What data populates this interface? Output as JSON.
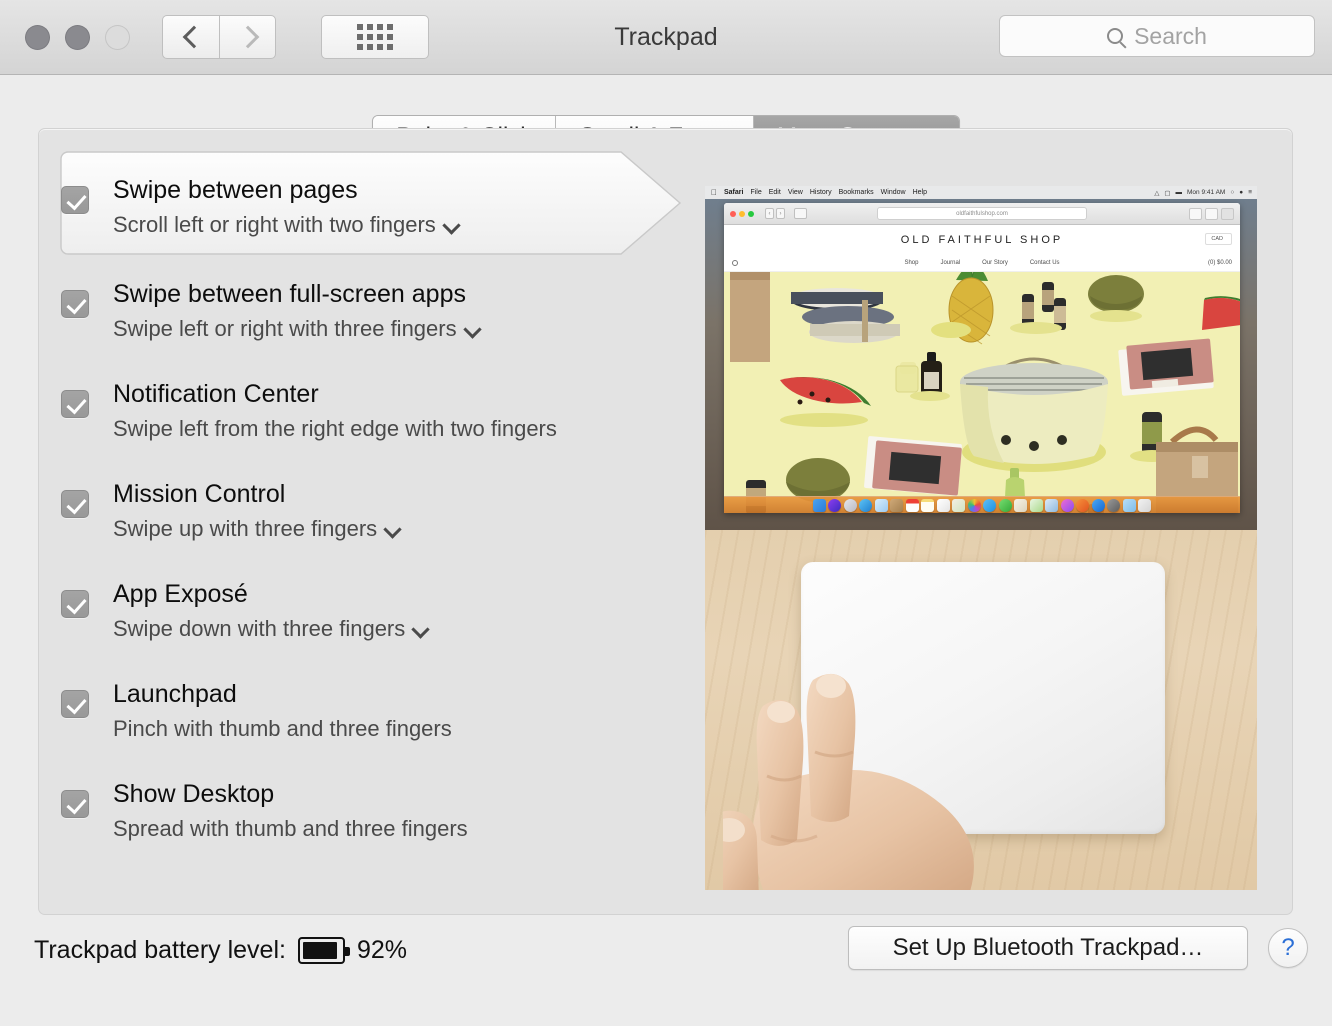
{
  "window": {
    "title": "Trackpad",
    "traffic_lights": [
      "close",
      "minimize",
      "zoom"
    ],
    "nav": {
      "back_icon": "chevron-left-icon",
      "forward_icon": "chevron-right-icon",
      "grid_icon": "show-all-grid-icon"
    }
  },
  "search": {
    "placeholder": "Search",
    "value": "",
    "icon": "search-icon"
  },
  "tabs": [
    {
      "label": "Point & Click",
      "active": false
    },
    {
      "label": "Scroll & Zoom",
      "active": false
    },
    {
      "label": "More Gestures",
      "active": true
    }
  ],
  "gestures": [
    {
      "title": "Swipe between pages",
      "subtitle": "Scroll left or right with two fingers",
      "checked": true,
      "has_menu": true,
      "selected": true
    },
    {
      "title": "Swipe between full-screen apps",
      "subtitle": "Swipe left or right with three fingers",
      "checked": true,
      "has_menu": true,
      "selected": false
    },
    {
      "title": "Notification Center",
      "subtitle": "Swipe left from the right edge with two fingers",
      "checked": true,
      "has_menu": false,
      "selected": false
    },
    {
      "title": "Mission Control",
      "subtitle": "Swipe up with three fingers",
      "checked": true,
      "has_menu": true,
      "selected": false
    },
    {
      "title": "App Exposé",
      "subtitle": "Swipe down with three fingers",
      "checked": true,
      "has_menu": true,
      "selected": false
    },
    {
      "title": "Launchpad",
      "subtitle": "Pinch with thumb and three fingers",
      "checked": true,
      "has_menu": false,
      "selected": false
    },
    {
      "title": "Show Desktop",
      "subtitle": "Spread with thumb and three fingers",
      "checked": true,
      "has_menu": false,
      "selected": false
    }
  ],
  "preview": {
    "desktop": {
      "menubar": {
        "apple": "",
        "app_name": "Safari",
        "menus": [
          "File",
          "Edit",
          "View",
          "History",
          "Bookmarks",
          "Window",
          "Help"
        ],
        "clock": "Mon 9:41 AM",
        "status_icons": [
          "wifi-icon",
          "airplay-icon",
          "battery-icon",
          "spotlight-search-icon",
          "siri-icon",
          "notification-center-icon"
        ]
      },
      "safari": {
        "url": "oldfaithfulshop.com",
        "back_icon": "‹",
        "forward_icon": "›",
        "sidebar_icon": "sidebar-icon",
        "share_icon": "share-icon",
        "tabs_icon": "new-tab-icon"
      },
      "website": {
        "logo": "OLD FAITHFUL SHOP",
        "currency": "CAD",
        "nav": [
          "Shop",
          "Journal",
          "Our Story",
          "Contact Us"
        ],
        "cart": "(0) $0.00",
        "search_icon": "search-icon",
        "hero_background": "#f2f0b4"
      },
      "dock_apps": [
        "finder-icon",
        "siri-icon",
        "launchpad-icon",
        "safari-icon",
        "mail-icon",
        "contacts-icon",
        "calendar-icon",
        "notes-icon",
        "reminders-icon",
        "maps-icon",
        "photos-icon",
        "messages-icon",
        "facetime-icon",
        "pages-icon",
        "numbers-icon",
        "keynote-icon",
        "itunes-icon",
        "ibooks-icon",
        "appstore-icon",
        "preferences-icon",
        "downloads-folder-icon",
        "trash-icon"
      ]
    },
    "trackpad_photo": {
      "description": "Hand with two fingers resting on a white Magic Trackpad on a light wood desk"
    }
  },
  "bottom": {
    "battery_label": "Trackpad battery level:",
    "battery_percent": "92%",
    "battery_fill": 92,
    "setup_button": "Set Up Bluetooth Trackpad…",
    "help_button": "?"
  },
  "colors": {
    "window_bg": "#ececec",
    "panel_bg": "#e3e3e3",
    "tab_active_bg": "#8f8f8f",
    "accent_blue": "#2b6fd6",
    "checkbox_gray": "#9d9d9d",
    "hero_yellow": "#f2f0b4",
    "dock_orange": "#e8963c"
  }
}
